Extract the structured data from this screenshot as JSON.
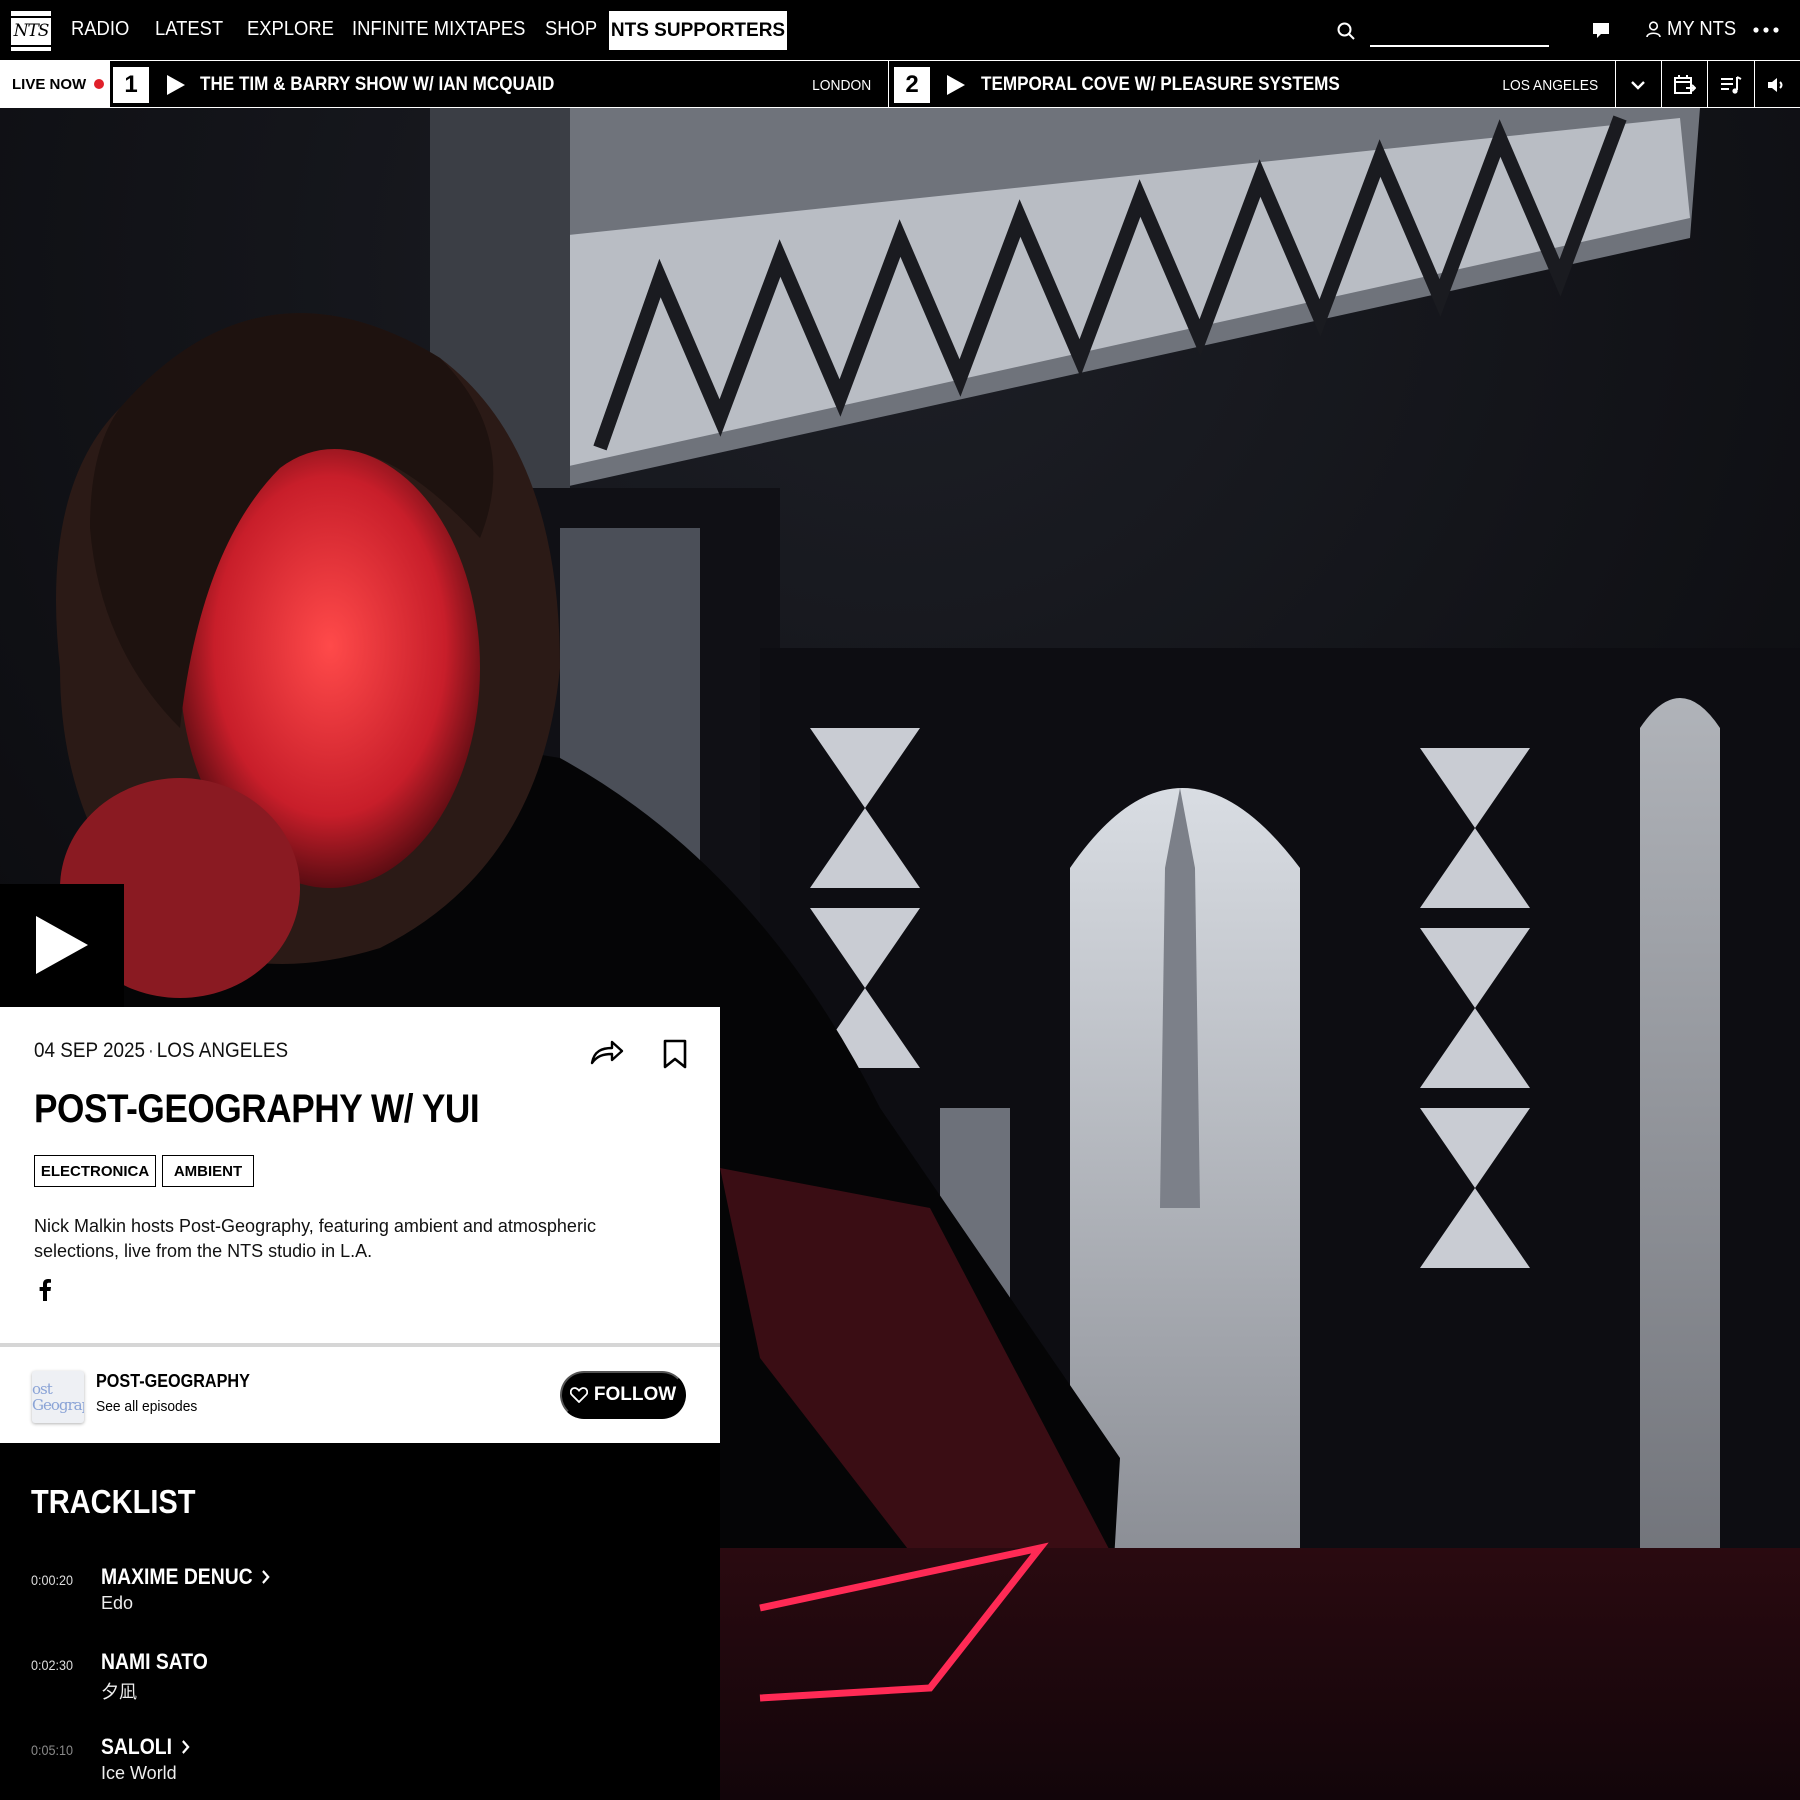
{
  "nav": {
    "logo_text": "NTS",
    "links": [
      "RADIO",
      "LATEST",
      "EXPLORE",
      "INFINITE MIXTAPES",
      "SHOP"
    ],
    "supporters": "NTS SUPPORTERS",
    "my_nts": "MY NTS",
    "search_placeholder": "",
    "icons": [
      "search-icon",
      "chat-icon",
      "user-icon",
      "more-icon"
    ]
  },
  "live": {
    "label": "LIVE NOW",
    "live_dot_color": "#e0202a",
    "channels": [
      {
        "number": "1",
        "show": "THE TIM & BARRY SHOW W/ IAN MCQUAID",
        "city": "LONDON"
      },
      {
        "number": "2",
        "show": "TEMPORAL COVE W/ PLEASURE SYSTEMS",
        "city": "LOS ANGELES"
      }
    ],
    "icons": [
      "chevron-down-icon",
      "schedule-icon",
      "playlist-icon",
      "volume-icon"
    ]
  },
  "episode": {
    "date": "04 SEP 2025",
    "location": "LOS ANGELES",
    "title": "POST-GEOGRAPHY W/ YUI",
    "genres": [
      "ELECTRONICA",
      "AMBIENT"
    ],
    "description": "Nick Malkin hosts Post-Geography, featuring ambient and atmospheric selections, live from the NTS studio in L.A.",
    "show": {
      "name": "POST-GEOGRAPHY",
      "see_all": "See all episodes",
      "thumb_text": "ost\nGeograp",
      "follow_label": "FOLLOW"
    }
  },
  "tracklist": {
    "heading": "TRACKLIST",
    "tracks": [
      {
        "time": "0:00:20",
        "artist": "MAXIME DENUC",
        "title": "Edo",
        "has_link": true
      },
      {
        "time": "0:02:30",
        "artist": "NAMI SATO",
        "title": "夕凪",
        "has_link": false
      },
      {
        "time": "0:05:10",
        "artist": "SALOLI",
        "title": "Ice World",
        "has_link": true
      }
    ]
  }
}
